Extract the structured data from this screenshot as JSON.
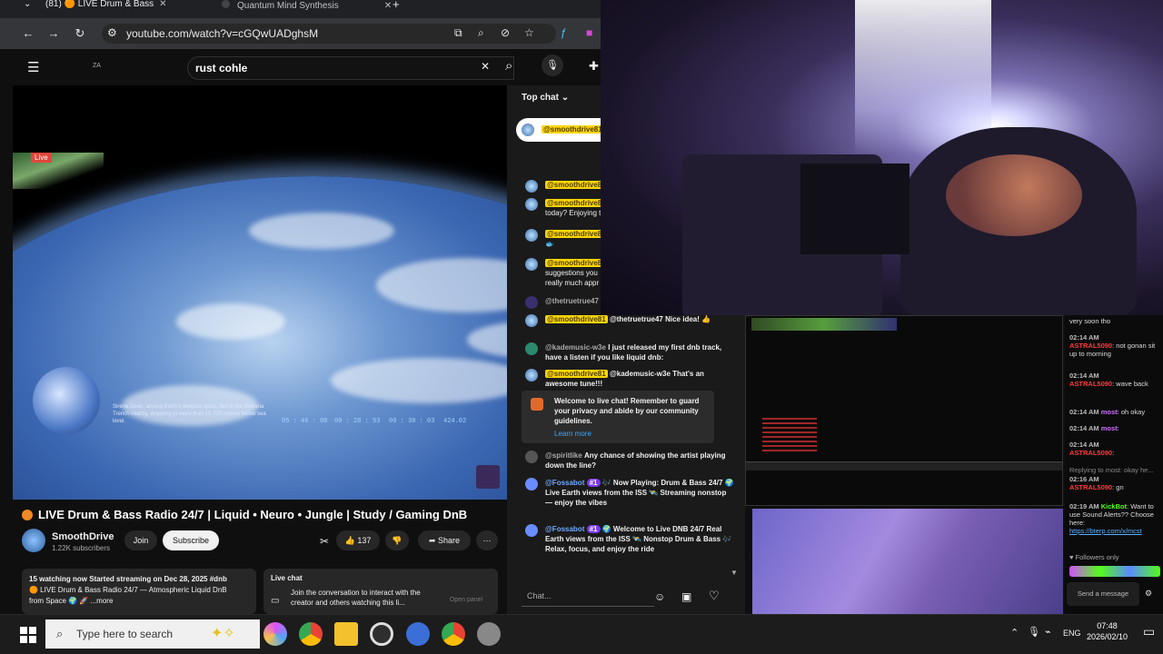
{
  "browser": {
    "tabs": [
      {
        "label": "(81) 🟠 LIVE Drum & Bass"
      },
      {
        "label": "Quantum Mind Synthesis"
      }
    ],
    "url": "youtube.com/watch?v=cGQwUADghsM"
  },
  "youtube": {
    "logo_text": "ZA",
    "search_value": "rust cohle",
    "video": {
      "live_badge": "Live",
      "caption": "Sirena Deep, among Earth's deepest spots, lies in the Mariana Trench nearby, dropping to more than 10,700 metres below sea level.",
      "stats": [
        "05 : 46 : 08",
        "00 : 28 : 53",
        "00 : 30 : 03",
        "424.02"
      ]
    },
    "title": "LIVE Drum & Bass Radio 24/7 | Liquid • Neuro • Jungle | Study / Gaming DnB",
    "channel": "SmoothDrive",
    "subscribers": "1.22K subscribers",
    "join": "Join",
    "subscribe": "Subscribe",
    "likes": "137",
    "share": "Share",
    "description": {
      "line1": "15 watching now  Started streaming on Dec 28, 2025  #dnb",
      "line2": "🟠 LIVE Drum & Bass Radio 24/7 — Atmospheric Liquid DnB",
      "line3": "from Space 🌍 🚀  ...more"
    },
    "live_chat_box": {
      "title": "Live chat",
      "text": "Join the conversation to interact with the creator and others watching this li...",
      "button": "Open panel"
    }
  },
  "chat": {
    "header": "Top chat",
    "pinned": "@smoothdrive81",
    "messages": [
      {
        "name": "@smoothdrive81",
        "text": ""
      },
      {
        "name": "@smoothdrive81",
        "text": "today? Enjoying t"
      },
      {
        "name": "@smoothdrive81",
        "text": "🐟"
      },
      {
        "name": "@smoothdrive81",
        "text": "suggestions you really much appr"
      },
      {
        "name": "@thetruetrue47",
        "text": ""
      },
      {
        "name": "@smoothdrive81",
        "text": "@thetruetrue47 Nice idea! 👍"
      },
      {
        "name": "@kademusic-w3e",
        "text": "I just released my first dnb track, have a listen if you like liquid dnb:"
      },
      {
        "name": "@smoothdrive81",
        "text": "@kademusic-w3e That's an awesome tune!!!"
      }
    ],
    "welcome": {
      "text": "Welcome to live chat! Remember to guard your privacy and abide by our community guidelines.",
      "link": "Learn more"
    },
    "messages2": [
      {
        "name": "@spiritlike",
        "text": "Any chance of showing the artist playing down the line?"
      },
      {
        "name": "@Fossabot",
        "badge": "#1",
        "text": "🎶 Now Playing: Drum & Bass 24/7 🌍 Live Earth views from the ISS 🛰️ Streaming nonstop — enjoy the vibes"
      },
      {
        "name": "@Fossabot",
        "badge": "#1",
        "text": "🌍 Welcome to Live DNB 24/7 Real Earth views from the ISS 🛰️ Nonstop Drum & Bass 🎶 Relax, focus, and enjoy the ride"
      }
    ],
    "input_placeholder": "Chat..."
  },
  "kick_chat": {
    "top": "very soon tho",
    "messages": [
      {
        "time": "02:14 AM",
        "name": "ASTRAL5090",
        "text": ": not gonan sit up to morning"
      },
      {
        "time": "02:14 AM",
        "name": "ASTRAL5090",
        "text": ": wave back"
      },
      {
        "time": "02:14 AM",
        "name": "most",
        "text": ": oh okay"
      },
      {
        "time": "02:14 AM",
        "name": "most",
        "text": ":"
      },
      {
        "time": "02:14 AM",
        "name": "ASTRAL5090",
        "text": ":"
      },
      {
        "time": "02:16 AM",
        "name": "ASTRAL5090",
        "text": ": gn",
        "reply": "Replying to most: okay he..."
      },
      {
        "time": "02:19 AM",
        "name": "KickBot",
        "text": ": Want to use Sound Alerts?? Choose here:",
        "link": "https://bterp.com/x/mcst"
      }
    ],
    "followers_only": "Followers only",
    "send": "Send a message"
  },
  "taskbar": {
    "search_placeholder": "Type here to search",
    "lang": "ENG",
    "time": "07:48",
    "date": "2026/02/10"
  }
}
